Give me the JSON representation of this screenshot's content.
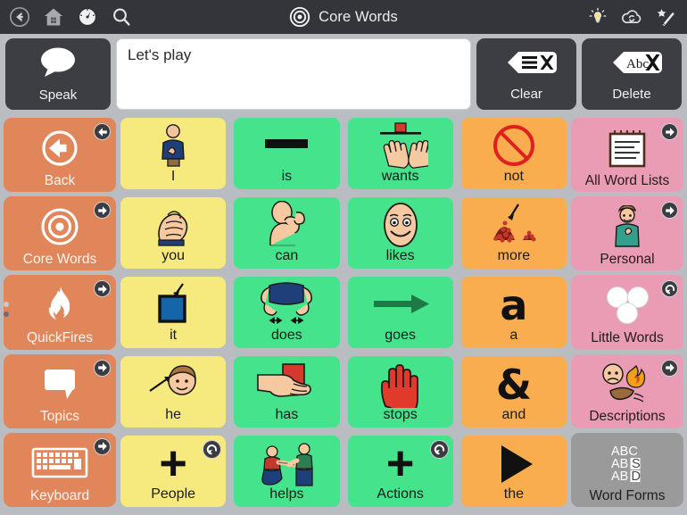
{
  "topbar": {
    "title": "Core Words",
    "left_icons": [
      {
        "name": "back-icon",
        "label": "Back"
      },
      {
        "name": "home-icon",
        "label": "Home"
      },
      {
        "name": "gauge-icon",
        "label": "Dashboard"
      },
      {
        "name": "search-icon",
        "label": "Search"
      }
    ],
    "title_icon": "target-icon",
    "right_icons": [
      {
        "name": "lightbulb-icon",
        "label": "Hints",
        "color": "#f5e27a"
      },
      {
        "name": "cloud-sync-icon",
        "label": "Sync"
      },
      {
        "name": "magic-wand-icon",
        "label": "Edit"
      }
    ]
  },
  "messagebar": {
    "speak_label": "Speak",
    "speak_icon": "speech-bubble-icon",
    "message_text": "Let's play",
    "message_placeholder": "",
    "clear_label": "Clear",
    "clear_icon": "clear-message-icon",
    "delete_label": "Delete",
    "delete_icon": "delete-word-icon"
  },
  "left_sidebar": {
    "items": [
      {
        "label": "Back",
        "icon": "back-arrow-circle-icon",
        "badge": "back-arrow-badge",
        "color": "#e0865a"
      },
      {
        "label": "Core Words",
        "icon": "target-icon",
        "badge": "forward-arrow-badge",
        "color": "#e0865a"
      },
      {
        "label": "QuickFires",
        "icon": "flame-icon",
        "badge": "forward-arrow-badge",
        "color": "#e0865a"
      },
      {
        "label": "Topics",
        "icon": "speech-bubble-icon",
        "badge": "forward-arrow-badge",
        "color": "#e0865a"
      },
      {
        "label": "Keyboard",
        "icon": "keyboard-icon",
        "badge": "forward-arrow-badge",
        "color": "#e0865a"
      }
    ]
  },
  "right_sidebar": {
    "items": [
      {
        "label": "All Word Lists",
        "icon": "notepad-icon",
        "badge": "forward-arrow-badge",
        "color": "#eb9cb5"
      },
      {
        "label": "Personal",
        "icon": "person-icon",
        "badge": "forward-arrow-badge",
        "color": "#eb9cb5"
      },
      {
        "label": "Little Words",
        "icon": "three-circles-icon",
        "badge": "return-arrow-badge",
        "color": "#eb9cb5"
      },
      {
        "label": "Descriptions",
        "icon": "face-and-fire-icon",
        "badge": "forward-arrow-badge",
        "color": "#eb9cb5"
      },
      {
        "label": "Word Forms",
        "icon": "abc-word-forms-icon",
        "badge": "",
        "color": "#9a9a9a"
      }
    ]
  },
  "page_dots": {
    "count": 2,
    "active_index": 0
  },
  "grid": {
    "columns": 4,
    "rows": 5,
    "colors": {
      "pronoun": "#f6e97e",
      "verb": "#45e48c",
      "other": "#f9ad4e"
    },
    "cells": [
      {
        "label": "I",
        "color": "pronoun",
        "icon": "person-pointing-self-icon",
        "badge": ""
      },
      {
        "label": "is",
        "color": "verb",
        "icon": "black-bar-icon",
        "badge": ""
      },
      {
        "label": "wants",
        "color": "verb",
        "icon": "hands-reaching-icon",
        "badge": ""
      },
      {
        "label": "not",
        "color": "other",
        "icon": "prohibition-sign-icon",
        "badge": ""
      },
      {
        "label": "you",
        "color": "pronoun",
        "icon": "pointing-hand-icon",
        "badge": ""
      },
      {
        "label": "can",
        "color": "verb",
        "icon": "flexing-arm-icon",
        "badge": ""
      },
      {
        "label": "likes",
        "color": "verb",
        "icon": "smiling-face-icon",
        "badge": ""
      },
      {
        "label": "more",
        "color": "other",
        "icon": "two-piles-icon",
        "badge": ""
      },
      {
        "label": "it",
        "color": "pronoun",
        "icon": "arrow-to-square-icon",
        "badge": ""
      },
      {
        "label": "does",
        "color": "verb",
        "icon": "person-doing-icon",
        "badge": ""
      },
      {
        "label": "goes",
        "color": "verb",
        "icon": "right-arrow-icon",
        "badge": ""
      },
      {
        "label": "a",
        "color": "other",
        "icon": "letter-a-icon",
        "badge": ""
      },
      {
        "label": "he",
        "color": "pronoun",
        "icon": "arrow-to-boy-face-icon",
        "badge": ""
      },
      {
        "label": "has",
        "color": "verb",
        "icon": "hand-holding-block-icon",
        "badge": ""
      },
      {
        "label": "stops",
        "color": "verb",
        "icon": "red-stop-hand-icon",
        "badge": ""
      },
      {
        "label": "and",
        "color": "other",
        "icon": "ampersand-icon",
        "badge": ""
      },
      {
        "label": "People",
        "color": "pronoun",
        "icon": "plus-icon",
        "badge": "return-arrow-badge"
      },
      {
        "label": "helps",
        "color": "verb",
        "icon": "two-people-helping-icon",
        "badge": ""
      },
      {
        "label": "Actions",
        "color": "verb",
        "icon": "plus-icon",
        "badge": "return-arrow-badge"
      },
      {
        "label": "the",
        "color": "other",
        "icon": "black-triangle-icon",
        "badge": ""
      }
    ]
  }
}
